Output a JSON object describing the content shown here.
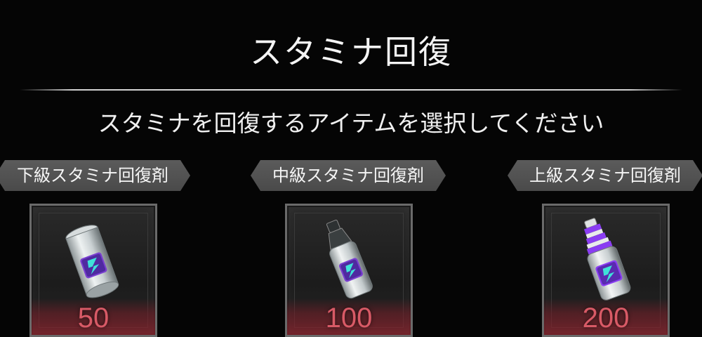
{
  "header": {
    "title": "スタミナ回復",
    "subtitle": "スタミナを回復するアイテムを選択してください"
  },
  "items": [
    {
      "label": "下級スタミナ回復剤",
      "value": "50",
      "icon": "can-icon"
    },
    {
      "label": "中級スタミナ回復剤",
      "value": "100",
      "icon": "bottle-icon"
    },
    {
      "label": "上級スタミナ回復剤",
      "value": "200",
      "icon": "premium-bottle-icon"
    }
  ],
  "colors": {
    "background": "#050505",
    "label_tag": "#555555",
    "value_text": "#d85a66",
    "accent_purple": "#8a3df2",
    "accent_teal": "#3fe1d9"
  }
}
